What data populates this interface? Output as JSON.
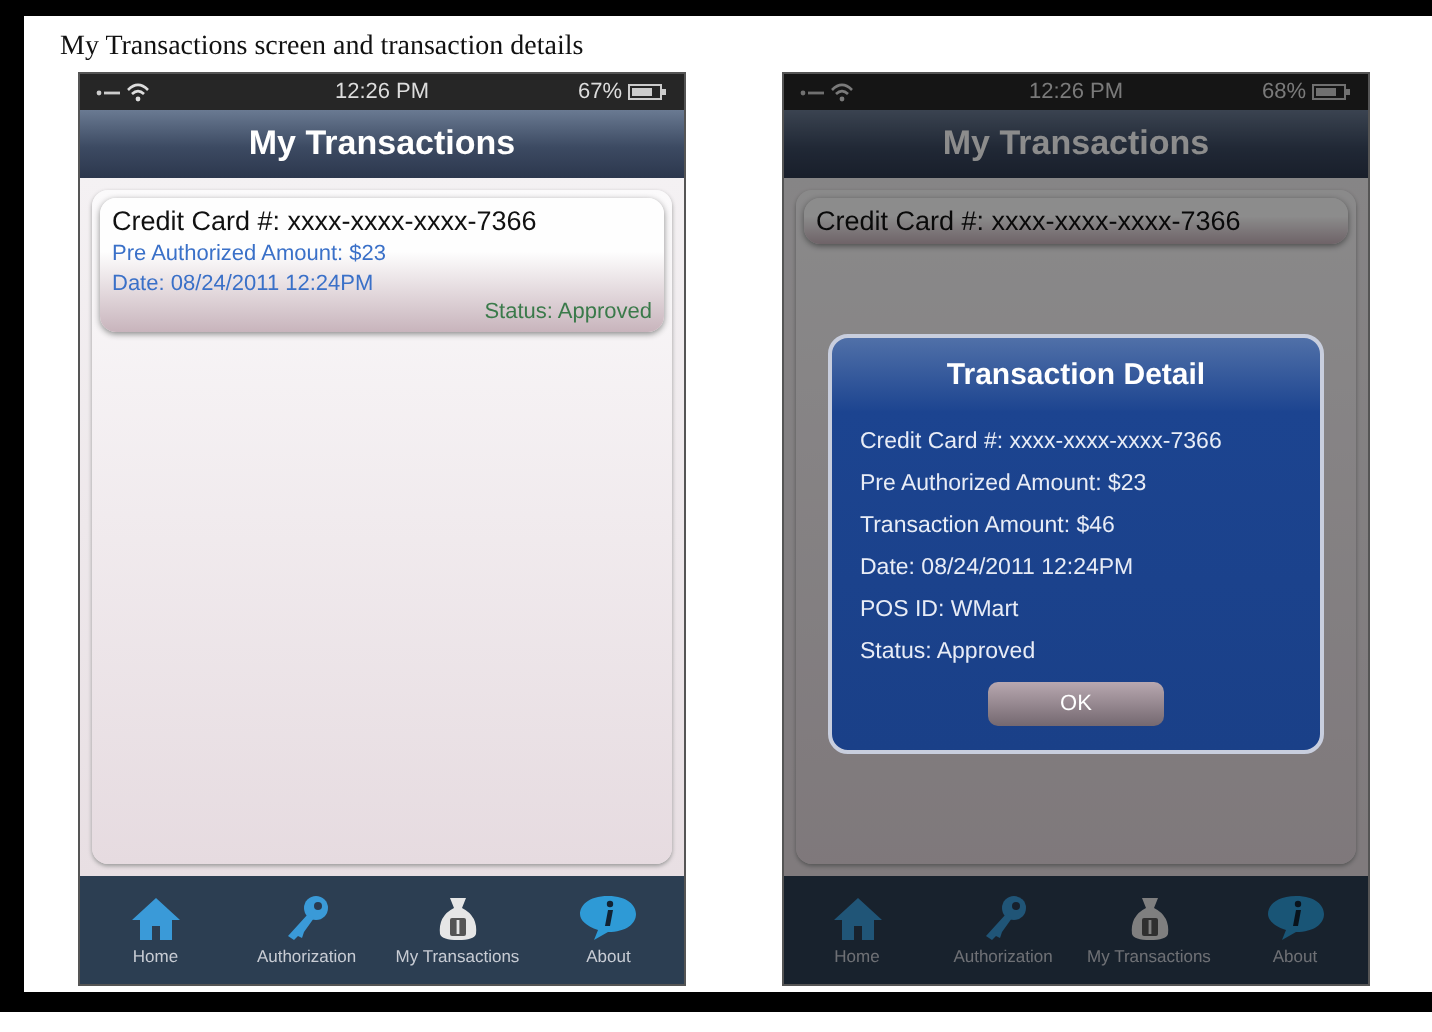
{
  "caption": "My Transactions screen and transaction details",
  "screens": [
    {
      "status_bar": {
        "time": "12:26 PM",
        "battery": "67%"
      },
      "title": "My Transactions",
      "transactions": [
        {
          "card": "Credit Card #: xxxx-xxxx-xxxx-7366",
          "pre_auth": "Pre Authorized Amount: $23",
          "date": "Date: 08/24/2011 12:24PM",
          "status": "Status: Approved"
        }
      ],
      "tab_bar": [
        {
          "kind": "home",
          "label": "Home"
        },
        {
          "kind": "key",
          "label": "Authorization"
        },
        {
          "kind": "bag",
          "label": "My Transactions"
        },
        {
          "kind": "info",
          "label": "About"
        }
      ]
    },
    {
      "status_bar": {
        "time": "12:26 PM",
        "battery": "68%"
      },
      "title": "My Transactions",
      "transactions": [
        {
          "card": "Credit Card #: xxxx-xxxx-xxxx-7366"
        }
      ],
      "tab_bar": [
        {
          "kind": "home",
          "label": "Home"
        },
        {
          "kind": "key",
          "label": "Authorization"
        },
        {
          "kind": "bag",
          "label": "My Transactions"
        },
        {
          "kind": "info",
          "label": "About"
        }
      ],
      "dialog": {
        "title": "Transaction Detail",
        "lines": [
          "Credit Card #: xxxx-xxxx-xxxx-7366",
          "Pre Authorized Amount: $23",
          "Transaction Amount: $46",
          "Date: 08/24/2011 12:24PM",
          "POS ID: WMart",
          "Status: Approved"
        ],
        "button": "OK"
      }
    }
  ]
}
